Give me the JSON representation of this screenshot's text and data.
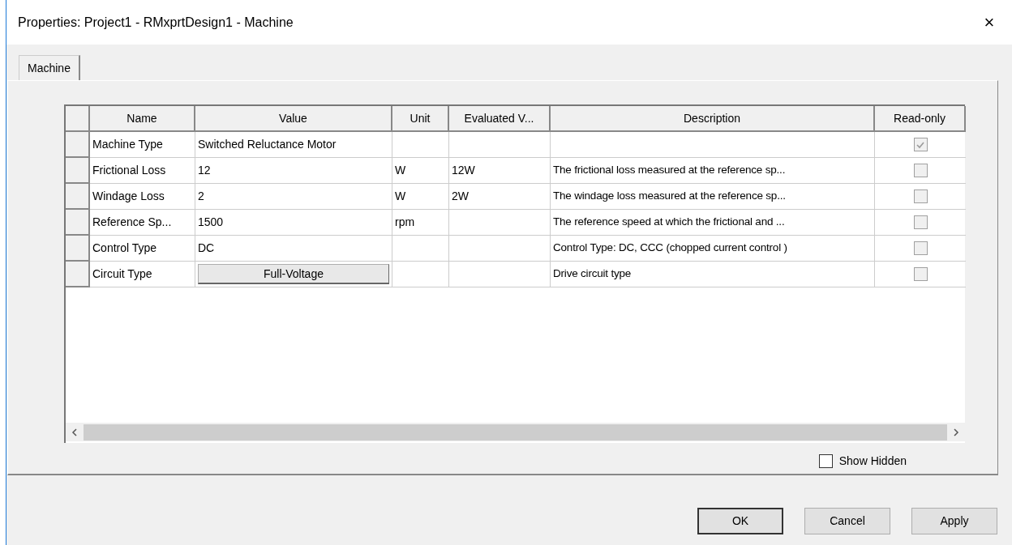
{
  "window": {
    "title": "Properties: Project1 - RMxprtDesign1 - Machine",
    "close": "×"
  },
  "tabs": [
    {
      "label": "Machine",
      "selected": true
    }
  ],
  "table": {
    "columns": [
      "Name",
      "Value",
      "Unit",
      "Evaluated V...",
      "Description",
      "Read-only"
    ],
    "rows": [
      {
        "name": "Machine Type",
        "value": {
          "kind": "text",
          "text": "Switched Reluctance Motor"
        },
        "unit": "",
        "evaluated": "",
        "description": "",
        "read_only": true
      },
      {
        "name": "Frictional Loss",
        "value": {
          "kind": "text",
          "text": "12"
        },
        "unit": "W",
        "evaluated": "12W",
        "description": "The frictional loss measured at the reference sp...",
        "read_only": false
      },
      {
        "name": "Windage Loss",
        "value": {
          "kind": "text",
          "text": "2"
        },
        "unit": "W",
        "evaluated": "2W",
        "description": "The windage loss measured at the reference sp...",
        "read_only": false
      },
      {
        "name": "Reference Sp...",
        "value": {
          "kind": "text",
          "text": "1500"
        },
        "unit": "rpm",
        "evaluated": "",
        "description": "The reference speed at which the frictional and ...",
        "read_only": false
      },
      {
        "name": "Control Type",
        "value": {
          "kind": "text",
          "text": "DC"
        },
        "unit": "",
        "evaluated": "",
        "description": "Control Type: DC, CCC (chopped current control )",
        "read_only": false
      },
      {
        "name": "Circuit Type",
        "value": {
          "kind": "button",
          "text": "Full-Voltage"
        },
        "unit": "",
        "evaluated": "",
        "description": "Drive circuit type",
        "read_only": false
      }
    ]
  },
  "show_hidden": {
    "label": "Show Hidden",
    "checked": false
  },
  "buttons": [
    "OK",
    "Cancel",
    "Apply"
  ]
}
